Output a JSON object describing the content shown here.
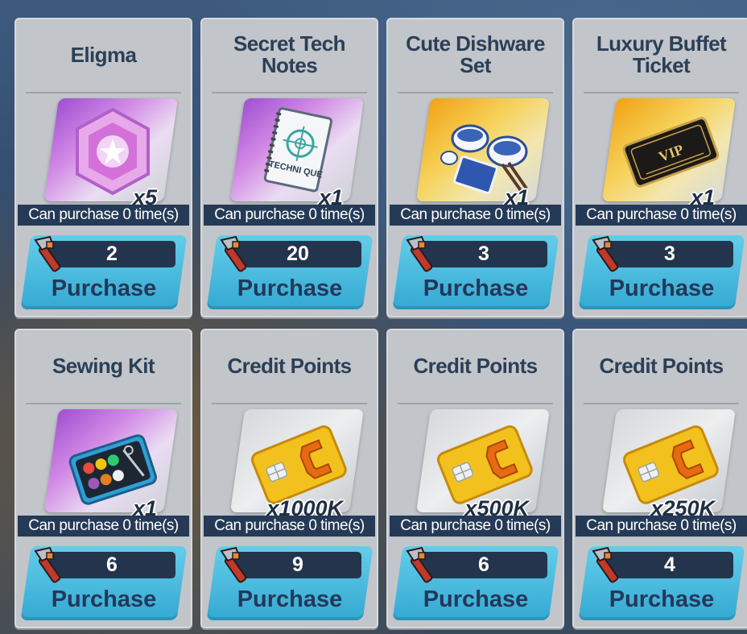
{
  "shop": {
    "items": [
      {
        "name": "Eligma",
        "quantity": "x5",
        "limit": "Can purchase 0 time(s)",
        "price": "2",
        "button_label": "Purchase",
        "icon": "eligma-crystal-icon",
        "frame": "purple"
      },
      {
        "name": "Secret Tech Notes",
        "quantity": "x1",
        "limit": "Can purchase 0 time(s)",
        "price": "20",
        "button_label": "Purchase",
        "icon": "tech-notes-icon",
        "frame": "purple",
        "notebook_text": "TECHNI QUE"
      },
      {
        "name": "Cute Dishware Set",
        "quantity": "x1",
        "limit": "Can purchase 0 time(s)",
        "price": "3",
        "button_label": "Purchase",
        "icon": "dishware-icon",
        "frame": "gold"
      },
      {
        "name": "Luxury Buffet Ticket",
        "quantity": "x1",
        "limit": "Can purchase 0 time(s)",
        "price": "3",
        "button_label": "Purchase",
        "icon": "vip-ticket-icon",
        "frame": "gold",
        "ticket_text": "VIP"
      },
      {
        "name": "Sewing Kit",
        "quantity": "x1",
        "limit": "Can purchase 0 time(s)",
        "price": "6",
        "button_label": "Purchase",
        "icon": "sewing-kit-icon",
        "frame": "purple"
      },
      {
        "name": "Credit Points",
        "quantity": "x1000K",
        "limit": "Can purchase 0 time(s)",
        "price": "9",
        "button_label": "Purchase",
        "icon": "credit-card-icon",
        "frame": "gray"
      },
      {
        "name": "Credit Points",
        "quantity": "x500K",
        "limit": "Can purchase 0 time(s)",
        "price": "6",
        "button_label": "Purchase",
        "icon": "credit-card-icon",
        "frame": "gray"
      },
      {
        "name": "Credit Points",
        "quantity": "x250K",
        "limit": "Can purchase 0 time(s)",
        "price": "4",
        "button_label": "Purchase",
        "icon": "credit-card-icon",
        "frame": "gray"
      }
    ],
    "currency_icon": "pipe-wrench-icon",
    "colors": {
      "card": "#c2c5c9",
      "title": "#2b3f57",
      "button": "#3eb4dc",
      "price_bar": "#23354d",
      "limit_bar": "#253a56"
    }
  }
}
